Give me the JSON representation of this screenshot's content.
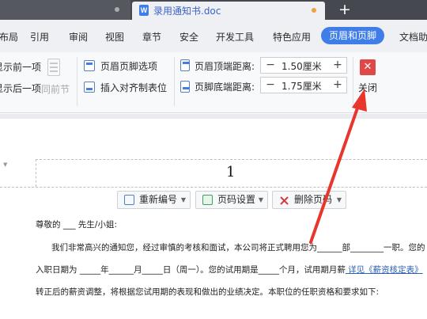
{
  "tabs": {
    "doc_icon": "W",
    "doc_title": "录用通知书.doc",
    "add_icon": "+"
  },
  "menu": {
    "items": [
      "布局",
      "引用",
      "审阅",
      "视图",
      "章节",
      "安全",
      "开发工具",
      "特色应用",
      "页眉和页脚",
      "文档助"
    ],
    "active_index": 8
  },
  "ribbon": {
    "show_prev": "显示前一项",
    "show_next": "显示后一项",
    "same_as_prev": "同前节",
    "header_footer_options": "页眉页脚选项",
    "insert_align_tab": "插入对齐制表位",
    "header_top_label": "页眉顶端距离:",
    "header_top_value": "1.50厘米",
    "footer_bottom_label": "页脚底端距离:",
    "footer_bottom_value": "1.75厘米",
    "minus": "−",
    "plus": "+",
    "close_label": "关闭",
    "close_icon": "✕"
  },
  "document": {
    "page_number": "1",
    "renumber": "重新编号",
    "page_number_settings": "页码设置",
    "delete_page_number": "删除页码",
    "greeting": "尊敬的 ___ 先生/小姐:",
    "line1": "我们非常高兴的通知您，经过审慎的考核和面试，本公司将正式聘用您为______部________一职。您的",
    "line2_prefix": "入职日期为 _____年______月_____日（周一）。您的试用期是_____个月，试用期月薪",
    "line2_link": " 详见《薪资核定表》",
    "line3": "转正后的薪资调整，将根据您试用期的表现和做出的业绩决定。本职位的任职资格和要求如下:"
  },
  "colors": {
    "accent": "#3f7ee8",
    "close_red": "#e04747",
    "annotation_red": "#e8352d"
  }
}
